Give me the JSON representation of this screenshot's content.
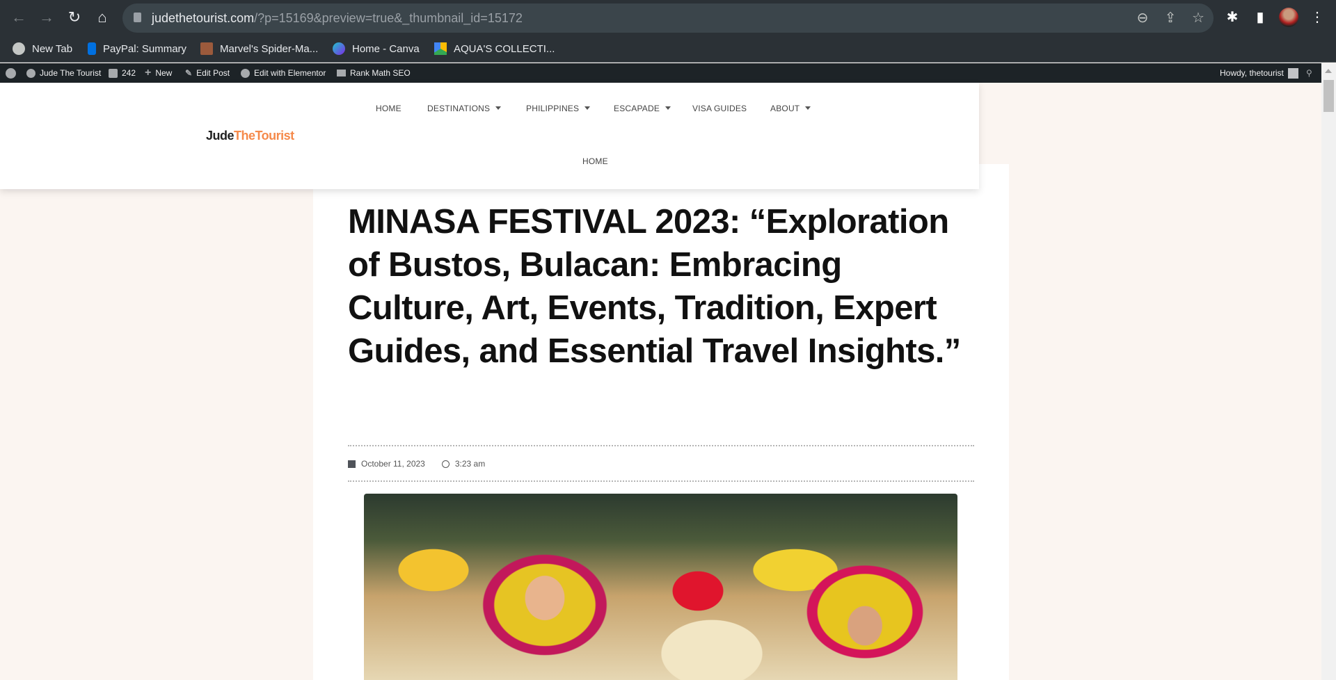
{
  "browser": {
    "url_host": "judethetourist.com",
    "url_rest": "/?p=15169&preview=true&_thumbnail_id=15172",
    "bookmarks": [
      {
        "label": "New Tab",
        "icon": "globe-icon"
      },
      {
        "label": "PayPal: Summary",
        "icon": "paypal-icon"
      },
      {
        "label": "Marvel's Spider-Ma...",
        "icon": "spiderman-thumbnail-icon"
      },
      {
        "label": "Home - Canva",
        "icon": "canva-icon"
      },
      {
        "label": "AQUA'S COLLECTI...",
        "icon": "google-drive-icon"
      }
    ]
  },
  "adminbar": {
    "site": "Jude The Tourist",
    "comments": "242",
    "new": "New",
    "edit_post": "Edit Post",
    "elementor": "Edit with Elementor",
    "rankmath": "Rank Math SEO",
    "howdy": "Howdy, thetourist"
  },
  "header": {
    "logo_a": "Jude",
    "logo_b": "TheTourist",
    "nav": [
      {
        "label": "HOME"
      },
      {
        "label": "DESTINATIONS"
      },
      {
        "label": "PHILIPPINES"
      },
      {
        "label": "ESCAPADE"
      },
      {
        "label": "VISA GUIDES"
      },
      {
        "label": "ABOUT"
      }
    ],
    "nav2": "HOME"
  },
  "post": {
    "title": "MINASA FESTIVAL 2023: “Exploration of Bustos, Bulacan: Embracing Culture, Art, Events, Tradition, Expert Guides, and Essential Travel Insights.”",
    "date": "October 11, 2023",
    "time": "3:23 am"
  },
  "colors": {
    "accent": "#f5894a",
    "adminbar": "#1d2327",
    "page_bg": "#fbf5f1"
  }
}
